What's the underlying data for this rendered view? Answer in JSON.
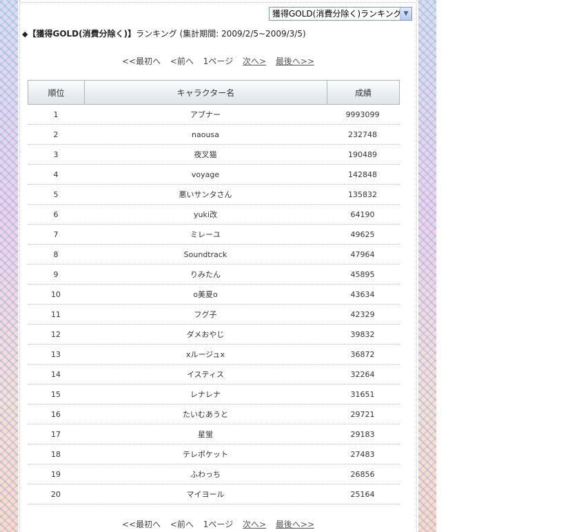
{
  "ranking_select": {
    "selected": "獲得GOLD(消費分除く)ランキング"
  },
  "heading": {
    "marker": "◆",
    "title": "【獲得GOLD(消費分除く)】",
    "suffix": "ランキング (集計期間: 2009/2/5~2009/3/5)"
  },
  "pager": {
    "first": "<<最初へ",
    "prev": "<前へ",
    "current": "1ページ",
    "next": "次へ>",
    "last": "最後へ>>"
  },
  "table": {
    "headers": [
      "順位",
      "キャラクター名",
      "成績"
    ],
    "rows": [
      {
        "rank": "1",
        "name": "アブナー",
        "score": "9993099"
      },
      {
        "rank": "2",
        "name": "naousa",
        "score": "232748"
      },
      {
        "rank": "3",
        "name": "夜叉猫",
        "score": "190489"
      },
      {
        "rank": "4",
        "name": "voyage",
        "score": "142848"
      },
      {
        "rank": "5",
        "name": "悪いサンタさん",
        "score": "135832"
      },
      {
        "rank": "6",
        "name": "yuki改",
        "score": "64190"
      },
      {
        "rank": "7",
        "name": "ミレーユ",
        "score": "49625"
      },
      {
        "rank": "8",
        "name": "Soundtrack",
        "score": "47964"
      },
      {
        "rank": "9",
        "name": "りみたん",
        "score": "45895"
      },
      {
        "rank": "10",
        "name": "o美夏o",
        "score": "43634"
      },
      {
        "rank": "11",
        "name": "フグ子",
        "score": "42329"
      },
      {
        "rank": "12",
        "name": "ダメおやじ",
        "score": "39832"
      },
      {
        "rank": "13",
        "name": "xルージュx",
        "score": "36872"
      },
      {
        "rank": "14",
        "name": "イスティス",
        "score": "32264"
      },
      {
        "rank": "15",
        "name": "レナレナ",
        "score": "31651"
      },
      {
        "rank": "16",
        "name": "たいむあうと",
        "score": "29721"
      },
      {
        "rank": "17",
        "name": "星蛍",
        "score": "29183"
      },
      {
        "rank": "18",
        "name": "テレポケット",
        "score": "27483"
      },
      {
        "rank": "19",
        "name": "ふわっち",
        "score": "26856"
      },
      {
        "rank": "20",
        "name": "マイヨール",
        "score": "25164"
      }
    ]
  }
}
